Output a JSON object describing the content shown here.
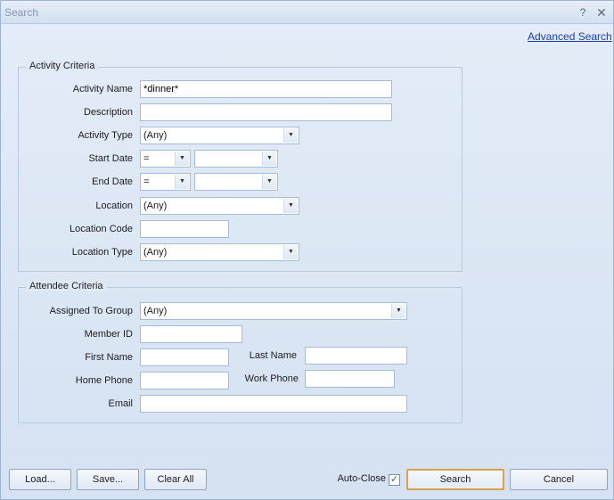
{
  "window": {
    "title": "Search",
    "help_glyph": "?",
    "close_glyph": "✕"
  },
  "advanced_search": "Advanced Search",
  "activity": {
    "legend": "Activity Criteria",
    "activity_name_label": "Activity Name",
    "activity_name_value": "*dinner*",
    "description_label": "Description",
    "description_value": "",
    "activity_type_label": "Activity Type",
    "activity_type_value": "(Any)",
    "start_date_label": "Start Date",
    "start_op": "=",
    "start_date_value": "",
    "end_date_label": "End Date",
    "end_op": "=",
    "end_date_value": "",
    "location_label": "Location",
    "location_value": "(Any)",
    "location_code_label": "Location Code",
    "location_code_value": "",
    "location_type_label": "Location Type",
    "location_type_value": "(Any)"
  },
  "attendee": {
    "legend": "Attendee Criteria",
    "group_label": "Assigned To Group",
    "group_value": "(Any)",
    "member_id_label": "Member ID",
    "member_id_value": "",
    "first_name_label": "First Name",
    "first_name_value": "",
    "last_name_label": "Last Name",
    "last_name_value": "",
    "home_phone_label": "Home Phone",
    "home_phone_value": "",
    "work_phone_label": "Work Phone",
    "work_phone_value": "",
    "email_label": "Email",
    "email_value": ""
  },
  "footer": {
    "load": "Load...",
    "save": "Save...",
    "clear_all": "Clear All",
    "auto_close_label": "Auto-Close",
    "auto_close_checked": true,
    "check_glyph": "✓",
    "search": "Search",
    "cancel": "Cancel"
  },
  "dropdown_arrow": "▼"
}
